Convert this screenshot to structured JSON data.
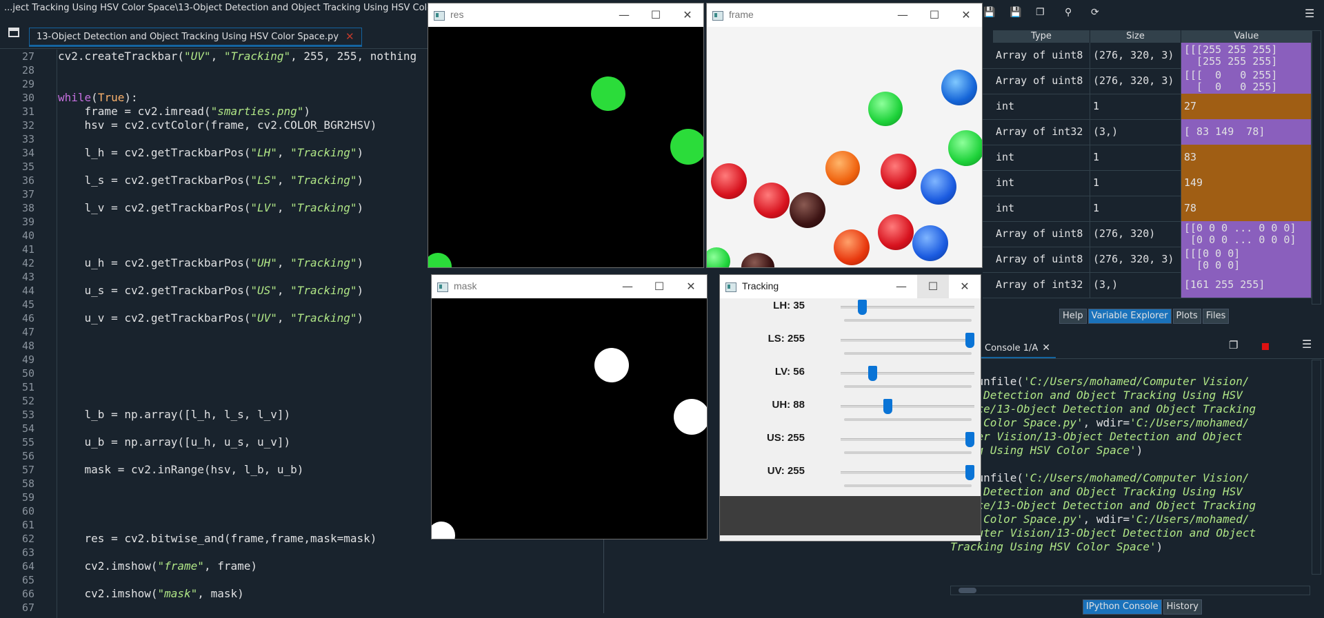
{
  "window": {
    "title": "...ject Tracking Using HSV Color Space\\13-Object Detection and Object Tracking Using HSV Color Space.py"
  },
  "editor": {
    "tab_label": "13-Object Detection and Object Tracking Using HSV Color Space.py",
    "tab_close": "✕",
    "line_numbers": [
      "27",
      "28",
      "29",
      "30",
      "31",
      "32",
      "33",
      "34",
      "35",
      "36",
      "37",
      "38",
      "39",
      "40",
      "41",
      "42",
      "43",
      "44",
      "45",
      "46",
      "47",
      "48",
      "49",
      "50",
      "51",
      "52",
      "53",
      "54",
      "55",
      "56",
      "57",
      "58",
      "59",
      "60",
      "61",
      "62",
      "63",
      "64",
      "65",
      "66",
      "67"
    ]
  },
  "code": {
    "l27": [
      "cv2.createTrackbar(",
      "\"UV\"",
      ", ",
      "\"Tracking\"",
      ", 255, 255, nothing"
    ],
    "l30": [
      "while",
      "(",
      "True",
      "):"
    ],
    "l31": [
      "    frame = cv2.imread(",
      "\"smarties.png\"",
      ")"
    ],
    "l32": "    hsv = cv2.cvtColor(frame, cv2.COLOR_BGR2HSV)",
    "l34": [
      "    l_h = cv2.getTrackbarPos(",
      "\"LH\"",
      ", ",
      "\"Tracking\"",
      ")"
    ],
    "l36": [
      "    l_s = cv2.getTrackbarPos(",
      "\"LS\"",
      ", ",
      "\"Tracking\"",
      ")"
    ],
    "l38": [
      "    l_v = cv2.getTrackbarPos(",
      "\"LV\"",
      ", ",
      "\"Tracking\"",
      ")"
    ],
    "l42": [
      "    u_h = cv2.getTrackbarPos(",
      "\"UH\"",
      ", ",
      "\"Tracking\"",
      ")"
    ],
    "l44": [
      "    u_s = cv2.getTrackbarPos(",
      "\"US\"",
      ", ",
      "\"Tracking\"",
      ")"
    ],
    "l46": [
      "    u_v = cv2.getTrackbarPos(",
      "\"UV\"",
      ", ",
      "\"Tracking\"",
      ")"
    ],
    "l53": "    l_b = np.array([l_h, l_s, l_v])",
    "l55": "    u_b = np.array([u_h, u_s, u_v])",
    "l57": "    mask = cv2.inRange(hsv, l_b, u_b)",
    "l62": "    res = cv2.bitwise_and(frame,frame,mask=mask)",
    "l64": [
      "    cv2.imshow(",
      "\"frame\"",
      ", frame)"
    ],
    "l66": [
      "    cv2.imshow(",
      "\"mask\"",
      ", mask)"
    ]
  },
  "variable_explorer": {
    "headers": [
      "Type",
      "Size",
      "Value"
    ],
    "rows": [
      {
        "type": "Array of uint8",
        "size": "(276, 320, 3)",
        "value": "[[[255 255 255]\n  [255 255 255]",
        "kind": "array"
      },
      {
        "type": "Array of uint8",
        "size": "(276, 320, 3)",
        "value": "[[[  0   0 255]\n  [  0   0 255]",
        "kind": "array"
      },
      {
        "type": "int",
        "size": "1",
        "value": "27",
        "kind": "int"
      },
      {
        "type": "Array of int32",
        "size": "(3,)",
        "value": "[ 83 149  78]",
        "kind": "array"
      },
      {
        "type": "int",
        "size": "1",
        "value": "83",
        "kind": "int"
      },
      {
        "type": "int",
        "size": "1",
        "value": "149",
        "kind": "int"
      },
      {
        "type": "int",
        "size": "1",
        "value": "78",
        "kind": "int"
      },
      {
        "type": "Array of uint8",
        "size": "(276, 320)",
        "value": "[[0 0 0 ... 0 0 0]\n [0 0 0 ... 0 0 0]",
        "kind": "array"
      },
      {
        "type": "Array of uint8",
        "size": "(276, 320, 3)",
        "value": "[[[0 0 0]\n  [0 0 0]",
        "kind": "array"
      },
      {
        "type": "Array of int32",
        "size": "(3,)",
        "value": "[161 255 255]",
        "kind": "array"
      }
    ],
    "pane_tabs": [
      "Help",
      "Variable Explorer",
      "Plots",
      "Files"
    ],
    "colors": {
      "array": "#8a5fbd",
      "int": "#a05e14"
    }
  },
  "console": {
    "tab_label": "Console 1/A",
    "tab_close": "✕",
    "lines": [
      {
        "prompt": "]: ",
        "text": "",
        "str": ""
      },
      {
        "prompt": "]: ",
        "text": "runfile(",
        "str": "'C:/Users/mohamed/Computer Vision/"
      },
      {
        "prompt": "",
        "text": "",
        "str": "ject Detection and Object Tracking Using HSV"
      },
      {
        "prompt": "",
        "text": "",
        "str": " Space/13-Object Detection and Object Tracking"
      },
      {
        "prompt": "",
        "text": "",
        "str": " HSV Color Space.py'",
        "tail": ", wdir=",
        "str2": "'C:/Users/mohamed/"
      },
      {
        "prompt": "",
        "text": "",
        "str": "mputer Vision/13-Object Detection and Object"
      },
      {
        "prompt": "",
        "text": "",
        "str": "cking Using HSV Color Space'",
        "tail": ")"
      },
      {
        "prompt": "",
        "text": "",
        "str": ""
      },
      {
        "prompt": "]: ",
        "text": "runfile(",
        "str": "'C:/Users/mohamed/Computer Vision/"
      },
      {
        "prompt": "",
        "text": "",
        "str": "ject Detection and Object Tracking Using HSV"
      },
      {
        "prompt": "",
        "text": "",
        "str": " Space/13-Object Detection and Object Tracking"
      },
      {
        "prompt": "",
        "text": "",
        "str": " HSV Color Space.py'",
        "tail": ", wdir=",
        "str2": "'C:/Users/mohamed/"
      },
      {
        "prompt": "",
        "text": "",
        "str": "Computer Vision/13-Object Detection and Object"
      },
      {
        "prompt": "",
        "text": "",
        "str": "Tracking Using HSV Color Space'",
        "tail": ")"
      }
    ],
    "pane_tabs": [
      "IPython Console",
      "History"
    ]
  },
  "cv_windows": {
    "res": {
      "title": "res"
    },
    "frame": {
      "title": "frame"
    },
    "mask": {
      "title": "mask"
    },
    "tracking": {
      "title": "Tracking"
    },
    "buttons": {
      "min": "—",
      "max": "☐",
      "close": "✕"
    }
  },
  "trackbars": [
    {
      "label": "LH: 35",
      "value": 35,
      "max": 255
    },
    {
      "label": "LS: 255",
      "value": 255,
      "max": 255
    },
    {
      "label": "LV: 56",
      "value": 56,
      "max": 255
    },
    {
      "label": "UH: 88",
      "value": 88,
      "max": 255
    },
    {
      "label": "US: 255",
      "value": 255,
      "max": 255
    },
    {
      "label": "UV: 255",
      "value": 255,
      "max": 255
    }
  ],
  "toolbar_icons": [
    "save-icon",
    "save-as-icon",
    "copy-icon",
    "search-icon",
    "refresh-icon",
    "menu-icon"
  ]
}
